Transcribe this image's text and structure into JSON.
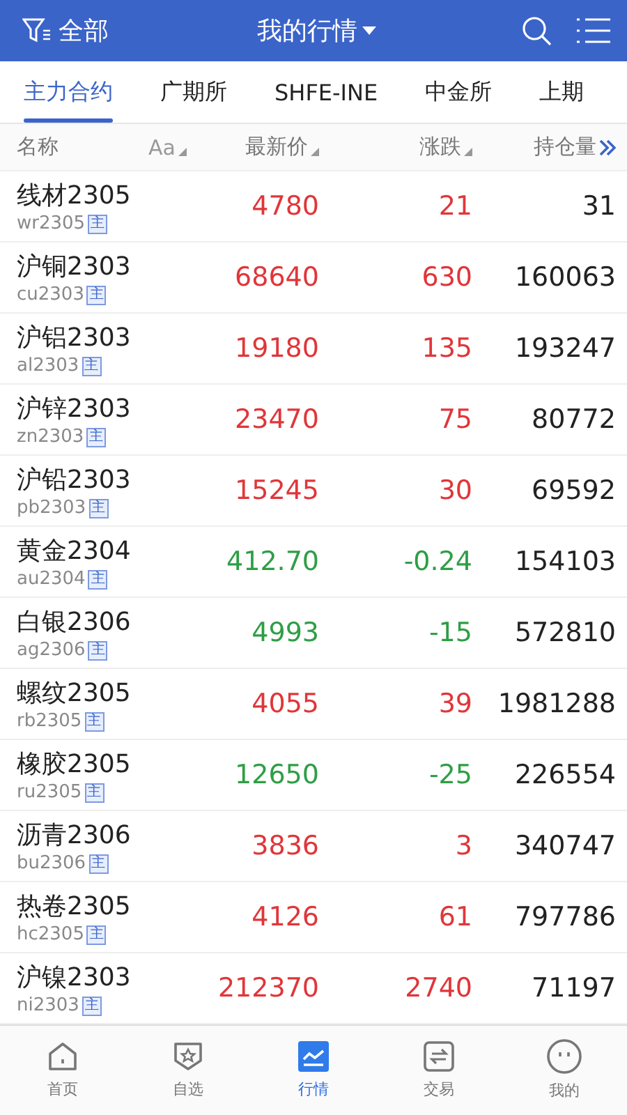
{
  "header": {
    "filter_label": "全部",
    "title": "我的行情"
  },
  "tabs": [
    {
      "label": "主力合约",
      "selected": true
    },
    {
      "label": "广期所",
      "selected": false
    },
    {
      "label": "SHFE-INE",
      "selected": false
    },
    {
      "label": "中金所",
      "selected": false
    },
    {
      "label": "上期",
      "selected": false
    }
  ],
  "table": {
    "columns": [
      {
        "label": "名称",
        "toggle": "Aa"
      },
      {
        "label": "最新价"
      },
      {
        "label": "涨跌"
      },
      {
        "label": "持仓量"
      }
    ],
    "rows": [
      {
        "name": "线材2305",
        "code": "wr2305",
        "tag": "主",
        "price": "4780",
        "change": "21",
        "open_interest": "31",
        "color": "#e0363a"
      },
      {
        "name": "沪铜2303",
        "code": "cu2303",
        "tag": "主",
        "price": "68640",
        "change": "630",
        "open_interest": "160063",
        "color": "#e0363a"
      },
      {
        "name": "沪铝2303",
        "code": "al2303",
        "tag": "主",
        "price": "19180",
        "change": "135",
        "open_interest": "193247",
        "color": "#e0363a"
      },
      {
        "name": "沪锌2303",
        "code": "zn2303",
        "tag": "主",
        "price": "23470",
        "change": "75",
        "open_interest": "80772",
        "color": "#e0363a"
      },
      {
        "name": "沪铅2303",
        "code": "pb2303",
        "tag": "主",
        "price": "15245",
        "change": "30",
        "open_interest": "69592",
        "color": "#e0363a"
      },
      {
        "name": "黄金2304",
        "code": "au2304",
        "tag": "主",
        "price": "412.70",
        "change": "-0.24",
        "open_interest": "154103",
        "color": "#2f9e46"
      },
      {
        "name": "白银2306",
        "code": "ag2306",
        "tag": "主",
        "price": "4993",
        "change": "-15",
        "open_interest": "572810",
        "color": "#2f9e46"
      },
      {
        "name": "螺纹2305",
        "code": "rb2305",
        "tag": "主",
        "price": "4055",
        "change": "39",
        "open_interest": "1981288",
        "color": "#e0363a"
      },
      {
        "name": "橡胶2305",
        "code": "ru2305",
        "tag": "主",
        "price": "12650",
        "change": "-25",
        "open_interest": "226554",
        "color": "#2f9e46"
      },
      {
        "name": "沥青2306",
        "code": "bu2306",
        "tag": "主",
        "price": "3836",
        "change": "3",
        "open_interest": "340747",
        "color": "#e0363a"
      },
      {
        "name": "热卷2305",
        "code": "hc2305",
        "tag": "主",
        "price": "4126",
        "change": "61",
        "open_interest": "797786",
        "color": "#e0363a"
      },
      {
        "name": "沪镍2303",
        "code": "ni2303",
        "tag": "主",
        "price": "212370",
        "change": "2740",
        "open_interest": "71197",
        "color": "#e0363a"
      }
    ]
  },
  "nav": [
    {
      "label": "首页",
      "kind": "home",
      "selected": false
    },
    {
      "label": "自选",
      "kind": "watchlist",
      "selected": false
    },
    {
      "label": "行情",
      "kind": "market",
      "selected": true
    },
    {
      "label": "交易",
      "kind": "trade",
      "selected": false
    },
    {
      "label": "我的",
      "kind": "profile",
      "selected": false
    }
  ]
}
